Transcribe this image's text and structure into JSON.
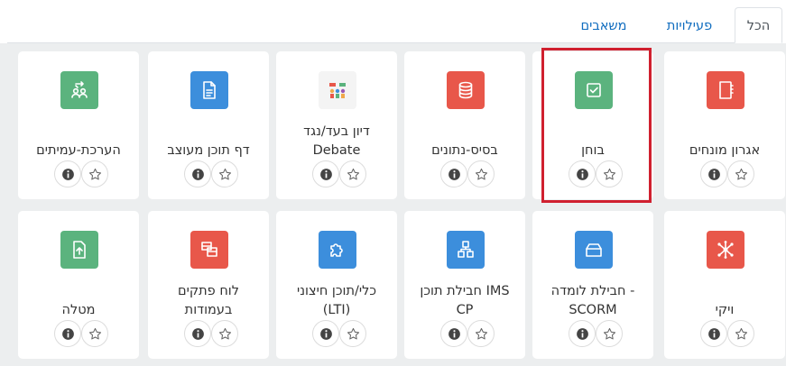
{
  "tabs": {
    "all": "הכל",
    "activities": "פעילויות",
    "resources": "משאבים"
  },
  "colors": {
    "green": "#5bb37e",
    "red": "#e8574a",
    "blue": "#3c8edc",
    "highlight": "#d0202f"
  },
  "modules": [
    {
      "name_lines": [
        "אגרון מונחים"
      ],
      "color": "red",
      "icon": "glossary-icon"
    },
    {
      "name_lines": [
        "בוחן"
      ],
      "color": "green",
      "icon": "quiz-icon"
    },
    {
      "name_lines": [
        "בסיס-נתונים"
      ],
      "color": "red",
      "icon": "database-icon"
    },
    {
      "name_lines": [
        "דיון בעד/נגד",
        "Debate"
      ],
      "color": "none",
      "icon": "debate-icon"
    },
    {
      "name_lines": [
        "דף תוכן מעוצב"
      ],
      "color": "blue",
      "icon": "page-icon"
    },
    {
      "name_lines": [
        "הערכת-עמיתים"
      ],
      "color": "green",
      "icon": "workshop-icon"
    },
    {
      "name_lines": [
        "ויקי"
      ],
      "color": "red",
      "icon": "wiki-icon"
    },
    {
      "name_lines": [
        "חבילת לומדה -",
        "SCORM"
      ],
      "color": "blue",
      "icon": "scorm-icon"
    },
    {
      "name_lines": [
        "חבילת תוכן IMS",
        "CP"
      ],
      "color": "blue",
      "icon": "ims-package-icon"
    },
    {
      "name_lines": [
        "כלי/תוכן חיצוני",
        "(LTI)"
      ],
      "color": "blue",
      "icon": "lti-icon"
    },
    {
      "name_lines": [
        "לוח פתקים",
        "בעמודות"
      ],
      "color": "red",
      "icon": "board-icon"
    },
    {
      "name_lines": [
        "מטלה"
      ],
      "color": "green",
      "icon": "assignment-icon"
    }
  ]
}
